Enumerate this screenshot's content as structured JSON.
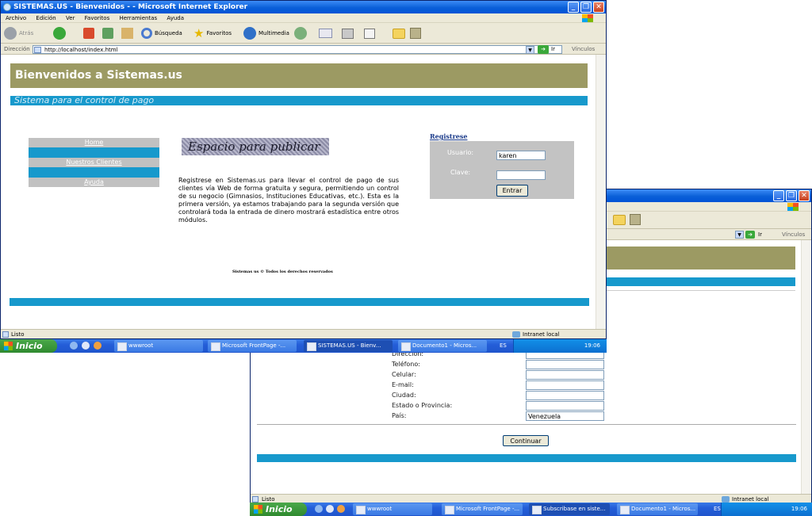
{
  "window1": {
    "title": "SISTEMAS.US - Bienvenidos - - Microsoft Internet Explorer",
    "menu": [
      "Archivo",
      "Edición",
      "Ver",
      "Favoritos",
      "Herramientas",
      "Ayuda"
    ],
    "toolbar": {
      "back": "Atrás",
      "search": "Búsqueda",
      "favorites": "Favoritos",
      "multimedia": "Multimedia"
    },
    "address_label": "Dirección",
    "address": "http://localhost/index.html",
    "go": "Ir",
    "links": "Vínculos"
  },
  "page": {
    "header": "Bienvenidos a Sistemas.us",
    "subtitle": "Sistema para el control de pago",
    "nav": [
      "Home",
      "Nuestros Clientes",
      "Ayuda"
    ],
    "banner": "Espacio para publicar",
    "body_text": "Registrese en Sistemas.us para llevar el control de pago de sus clientes vía Web de forma gratuita y segura, permitiendo un control de su negocio (Gimnasios, Instituciones Educativas, etc.). Esta es la primera versión, ya estamos trabajando para la segunda versión que controlará toda la entrada de dinero mostrará estadística entre otros módulos.",
    "register_link": "Registrese",
    "usuario_label": "Usuario:",
    "usuario_value": "karen",
    "clave_label": "Clave:",
    "entrar": "Entrar",
    "footer": "Sistemas us © Todos los derechos reservados"
  },
  "status1": {
    "left": "Listo",
    "zone": "Intranet local"
  },
  "taskbar1": {
    "start": "Inicio",
    "tasks": [
      "wwwroot",
      "Microsoft FrontPage -...",
      "SISTEMAS.US - Bienv...",
      "Documento1 - Micros..."
    ],
    "lang": "ES",
    "time": "19:06"
  },
  "window2": {
    "go": "Ir",
    "links": "Vínculos",
    "form_labels": [
      "Dirección:",
      "Teléfono:",
      "Celular:",
      "E-mail:",
      "Ciudad:",
      "Estado o Provincia:",
      "País:"
    ],
    "pais_value": "Venezuela",
    "continuar": "Continuar"
  },
  "status2": {
    "left": "Listo",
    "zone": "Intranet local"
  },
  "taskbar2": {
    "start": "Inicio",
    "tasks": [
      "wwwroot",
      "Microsoft FrontPage -...",
      "Subscribase en siste...",
      "Documento1 - Micros..."
    ],
    "lang": "ES",
    "time": "19:06"
  }
}
